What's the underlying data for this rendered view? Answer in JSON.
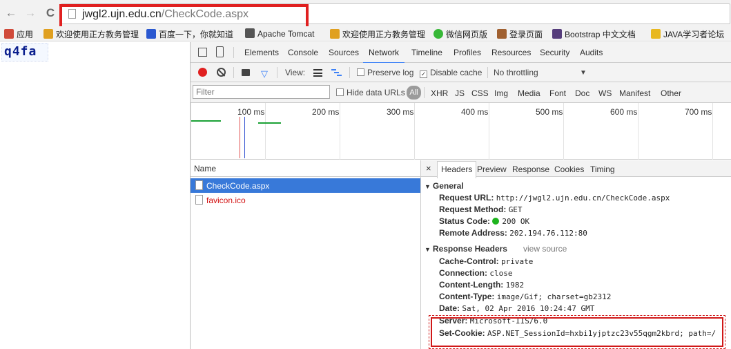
{
  "browser": {
    "back": "←",
    "forward": "→",
    "reload": "C",
    "url_host": "jwgl2.ujn.edu.cn",
    "url_path": "/CheckCode.aspx"
  },
  "bookmarks": [
    {
      "label": "应用",
      "color": "#d04a3a"
    },
    {
      "label": "欢迎使用正方教务管理",
      "color": "#e0a020"
    },
    {
      "label": "百度一下，你就知道",
      "color": "#2a58d0"
    },
    {
      "label": "Apache Tomcat",
      "color": "#555555"
    },
    {
      "label": "欢迎使用正方教务管理",
      "color": "#e0a020"
    },
    {
      "label": "微信网页版",
      "color": "#38b838"
    },
    {
      "label": "登录页面",
      "color": "#a06030"
    },
    {
      "label": "Bootstrap 中文文档",
      "color": "#563d7c"
    },
    {
      "label": "JAVA学习者论坛",
      "color": "#e8b820"
    }
  ],
  "page": {
    "captcha_text": "q4fa"
  },
  "devtools": {
    "tabs": [
      "Elements",
      "Console",
      "Sources",
      "Network",
      "Timeline",
      "Profiles",
      "Resources",
      "Security",
      "Audits"
    ],
    "active_tab": "Network",
    "toolbar": {
      "view_label": "View:",
      "preserve_log": "Preserve log",
      "disable_cache": "Disable cache",
      "throttling": "No throttling",
      "dropdown": "▼"
    },
    "filter": {
      "placeholder": "Filter",
      "hide_data_urls": "Hide data URLs",
      "all": "All",
      "types": [
        "XHR",
        "JS",
        "CSS",
        "Img",
        "Media",
        "Font",
        "Doc",
        "WS",
        "Manifest",
        "Other"
      ]
    },
    "timeline_ticks": [
      "100 ms",
      "200 ms",
      "300 ms",
      "400 ms",
      "500 ms",
      "600 ms",
      "700 ms"
    ],
    "list_header": "Name",
    "requests": [
      {
        "name": "CheckCode.aspx",
        "selected": true,
        "error": false
      },
      {
        "name": "favicon.ico",
        "selected": false,
        "error": true
      }
    ],
    "detail_tabs": [
      "Headers",
      "Preview",
      "Response",
      "Cookies",
      "Timing"
    ],
    "close": "×",
    "general": {
      "title": "General",
      "rows": [
        {
          "key": "Request URL:",
          "value": "http://jwgl2.ujn.edu.cn/CheckCode.aspx"
        },
        {
          "key": "Request Method:",
          "value": "GET"
        },
        {
          "key": "Status Code:",
          "value": "200 OK"
        },
        {
          "key": "Remote Address:",
          "value": "202.194.76.112:80"
        }
      ]
    },
    "response_headers": {
      "title": "Response Headers",
      "view_source": "view source",
      "rows": [
        {
          "key": "Cache-Control:",
          "value": "private"
        },
        {
          "key": "Connection:",
          "value": "close"
        },
        {
          "key": "Content-Length:",
          "value": "1982"
        },
        {
          "key": "Content-Type:",
          "value": "image/Gif; charset=gb2312"
        },
        {
          "key": "Date:",
          "value": "Sat, 02 Apr 2016 10:24:47 GMT"
        },
        {
          "key": "Server:",
          "value": "Microsoft-IIS/6.0"
        },
        {
          "key": "Set-Cookie:",
          "value": "ASP.NET_SessionId=hxbi1yjptzc23v55qgm2kbrd; path=/"
        }
      ]
    }
  }
}
